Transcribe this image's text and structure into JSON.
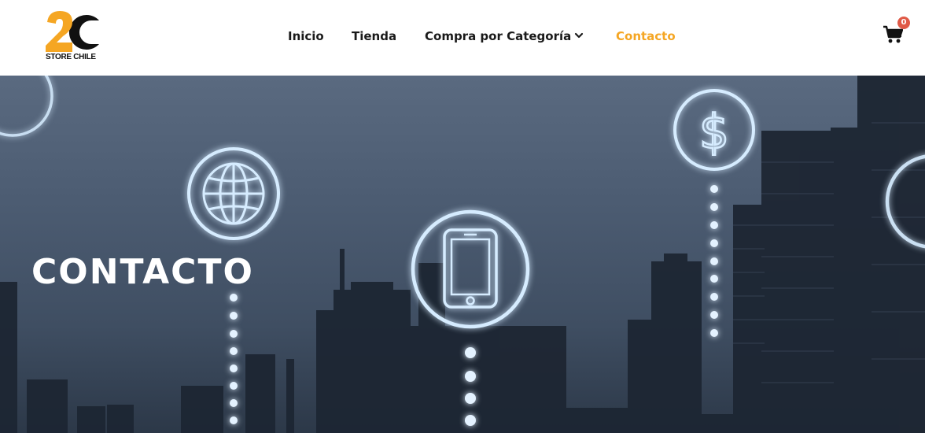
{
  "brand": {
    "logo_text": "STORE CHILE",
    "colors": {
      "accent": "#f5a623",
      "badge": "#e05a47",
      "text": "#1a1a1a"
    }
  },
  "nav": {
    "items": [
      {
        "label": "Inicio"
      },
      {
        "label": "Tienda"
      },
      {
        "label": "Compra por Categoría"
      },
      {
        "label": "Contacto"
      }
    ]
  },
  "cart": {
    "count": "0",
    "icon": "cart-icon"
  },
  "hero": {
    "title": "CONTACTO",
    "icons": [
      "globe-icon",
      "phone-icon",
      "dollar-icon"
    ]
  }
}
